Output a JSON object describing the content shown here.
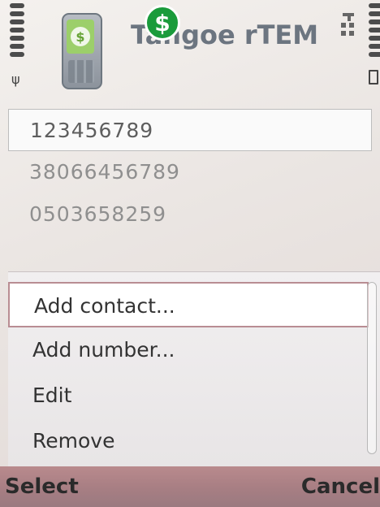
{
  "header": {
    "app_title": "Tangoe rTEM",
    "badge_symbol": "$"
  },
  "numbers": [
    {
      "value": "123456789",
      "selected": true
    },
    {
      "value": "38066456789",
      "selected": false
    },
    {
      "value": "0503658259",
      "selected": false
    }
  ],
  "options_menu": {
    "items": [
      {
        "label": "Add contact..."
      },
      {
        "label": "Add number..."
      },
      {
        "label": "Edit"
      },
      {
        "label": "Remove"
      }
    ]
  },
  "softkeys": {
    "left": "Select",
    "right": "Cancel"
  },
  "colors": {
    "badge_green": "#1a9b3b",
    "softkey_bar": "#a77e83",
    "highlight_border": "#b98d93"
  }
}
